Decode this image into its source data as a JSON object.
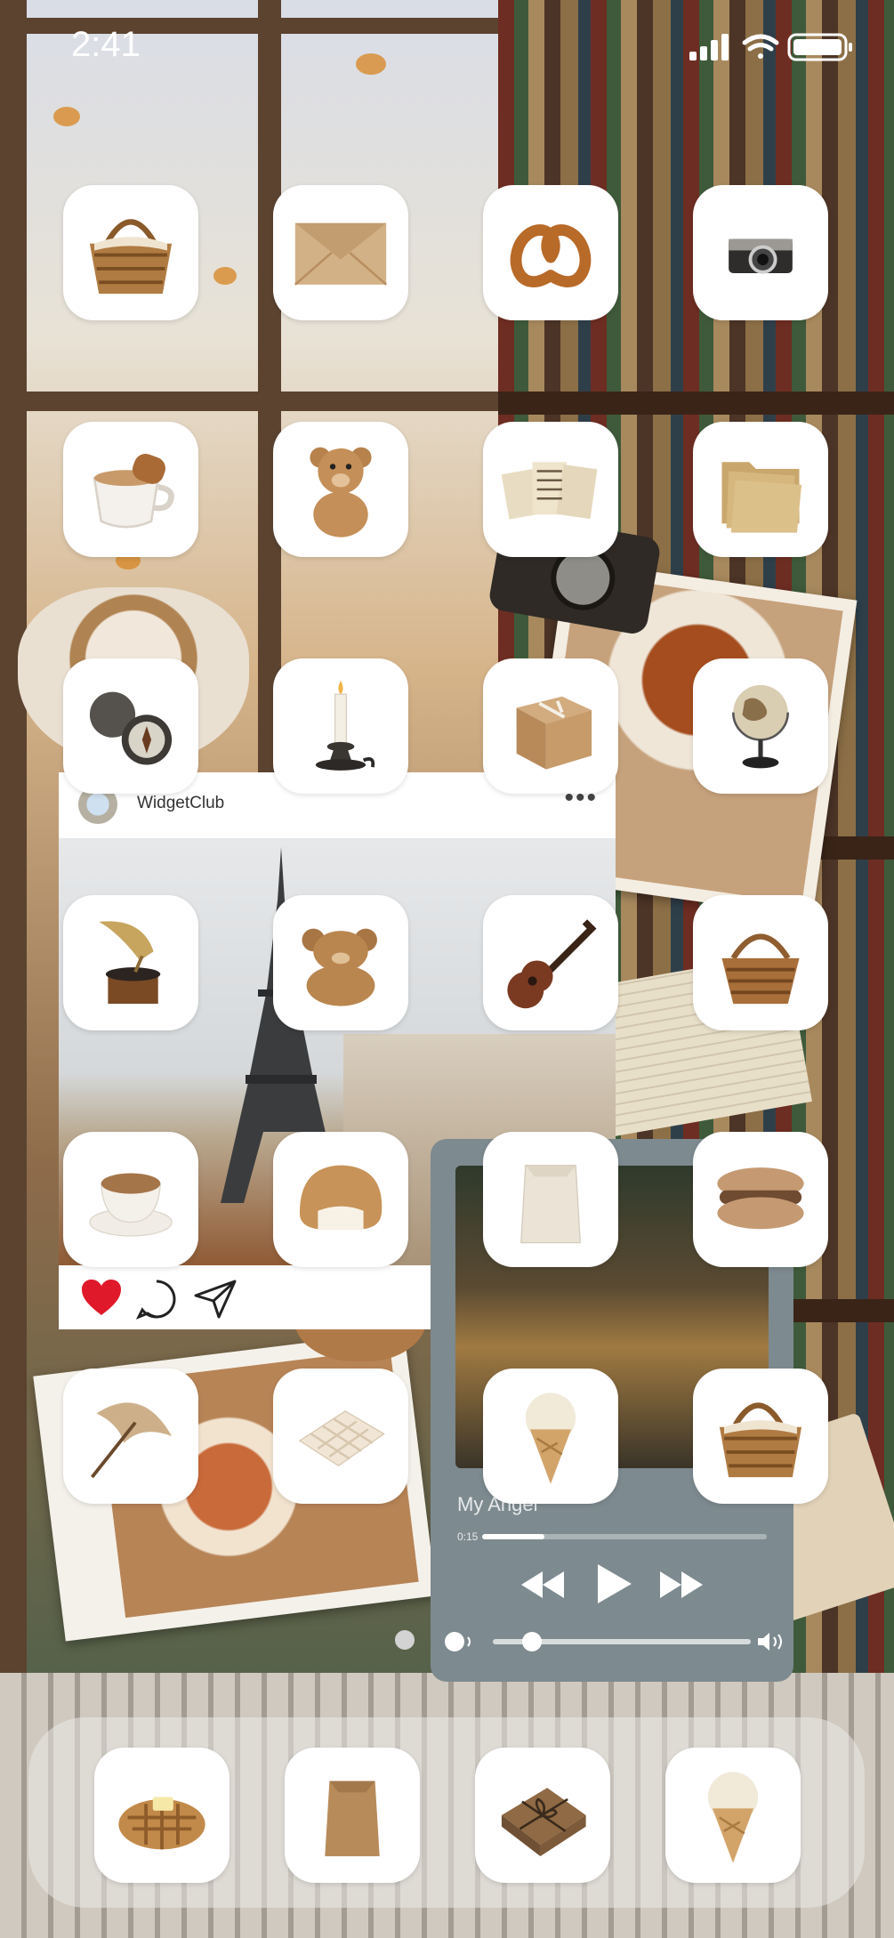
{
  "status": {
    "time": "2:41",
    "icons": [
      "cellular-signal-icon",
      "wifi-icon",
      "battery-icon"
    ]
  },
  "colors": {
    "app_bg": "#ffffff",
    "heart": "#e0192a",
    "music_panel": "#7d8a8f"
  },
  "home_apps": [
    {
      "icon": "picnic-basket-icon"
    },
    {
      "icon": "envelope-icon"
    },
    {
      "icon": "pretzel-icon"
    },
    {
      "icon": "camera-icon"
    },
    {
      "icon": "coffee-cup-icon"
    },
    {
      "icon": "teddy-bear-icon"
    },
    {
      "icon": "newspaper-icon"
    },
    {
      "icon": "folder-icon"
    },
    {
      "icon": "compass-icon"
    },
    {
      "icon": "candle-icon"
    },
    {
      "icon": "gift-box-icon"
    },
    {
      "icon": "globe-icon"
    },
    {
      "icon": "gramophone-icon"
    },
    {
      "icon": "plush-bear-icon"
    },
    {
      "icon": "ukulele-icon"
    },
    {
      "icon": "wicker-basket-icon"
    },
    {
      "icon": "teacup-icon"
    },
    {
      "icon": "cream-bun-icon"
    },
    {
      "icon": "paper-bag-icon"
    },
    {
      "icon": "macaron-icon"
    },
    {
      "icon": "parasol-icon"
    },
    {
      "icon": "white-chocolate-icon"
    },
    {
      "icon": "ice-cream-icon"
    },
    {
      "icon": "picnic-basket-icon"
    }
  ],
  "dock_apps": [
    {
      "icon": "waffle-icon"
    },
    {
      "icon": "paper-bag-icon"
    },
    {
      "icon": "wrapped-gift-icon"
    },
    {
      "icon": "ice-cream-icon"
    }
  ],
  "widget_post": {
    "account_name": "WidgetClub",
    "more": "•••",
    "liked": true
  },
  "music_player": {
    "title": "My Angel",
    "time_elapsed": "0:15",
    "progress": 0.22,
    "volume": 0.15
  },
  "page_indicator": {
    "pages": 1,
    "current": 1
  }
}
